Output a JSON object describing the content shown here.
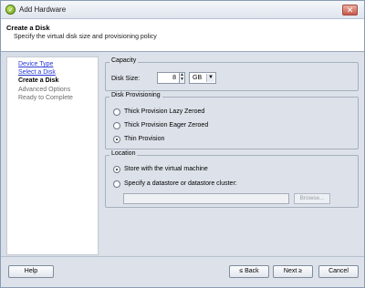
{
  "window": {
    "title": "Add Hardware",
    "close_symbol": "✕",
    "app_icon_glyph": "✓"
  },
  "header": {
    "title": "Create a Disk",
    "subtitle": "Specify the virtual disk size and provisioning policy"
  },
  "nav": {
    "items": [
      {
        "label": "Device Type",
        "state": "link"
      },
      {
        "label": "Select a Disk",
        "state": "link"
      },
      {
        "label": "Create a Disk",
        "state": "current"
      },
      {
        "label": "Advanced Options",
        "state": "muted"
      },
      {
        "label": "Ready to Complete",
        "state": "muted"
      }
    ]
  },
  "capacity": {
    "legend": "Capacity",
    "disk_size_label": "Disk Size:",
    "disk_size_value": "8",
    "unit_value": "GB"
  },
  "provisioning": {
    "legend": "Disk Provisioning",
    "options": [
      {
        "label": "Thick Provision Lazy Zeroed",
        "checked": false
      },
      {
        "label": "Thick Provision Eager Zeroed",
        "checked": false
      },
      {
        "label": "Thin Provision",
        "checked": true
      }
    ]
  },
  "location": {
    "legend": "Location",
    "options": [
      {
        "label": "Store with the virtual machine",
        "checked": true
      },
      {
        "label": "Specify a datastore or datastore cluster:",
        "checked": false
      }
    ],
    "browse_label": "Browse..."
  },
  "footer": {
    "help_label": "Help",
    "back_label": "≤ Back",
    "next_label": "Next ≥",
    "cancel_label": "Cancel"
  }
}
